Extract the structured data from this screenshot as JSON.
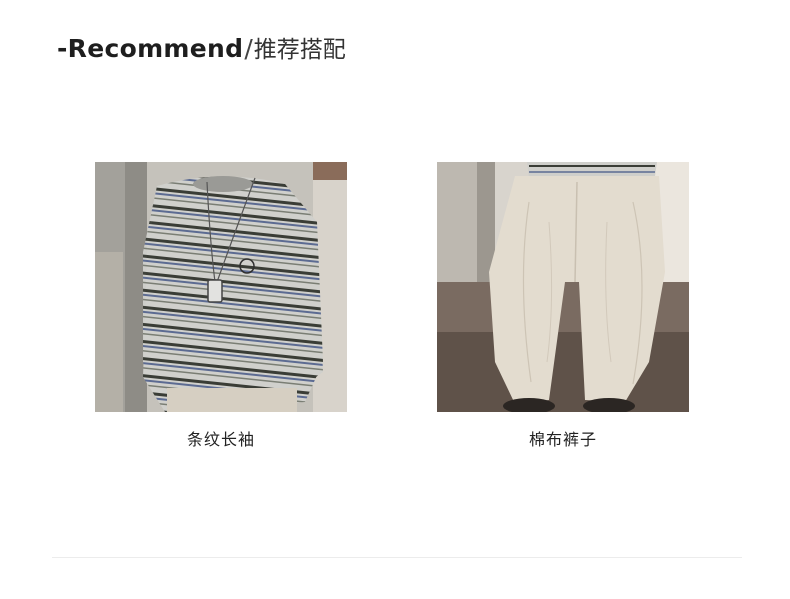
{
  "header": {
    "title_en": "-Recommend",
    "separator": "/",
    "title_cn": "推荐搭配"
  },
  "products": [
    {
      "label": "条纹长袖",
      "image_subject": "striped-long-sleeve-shirt"
    },
    {
      "label": "棉布裤子",
      "image_subject": "cotton-wide-pants"
    }
  ],
  "colors": {
    "text": "#222222",
    "stripe_dark": "#3a3d36",
    "stripe_blue": "#5c6b92",
    "shirt_base": "#c9c9c6",
    "pants": "#ddd6c8",
    "background_wall": "#bcbab3",
    "floor": "#6b5e55"
  }
}
